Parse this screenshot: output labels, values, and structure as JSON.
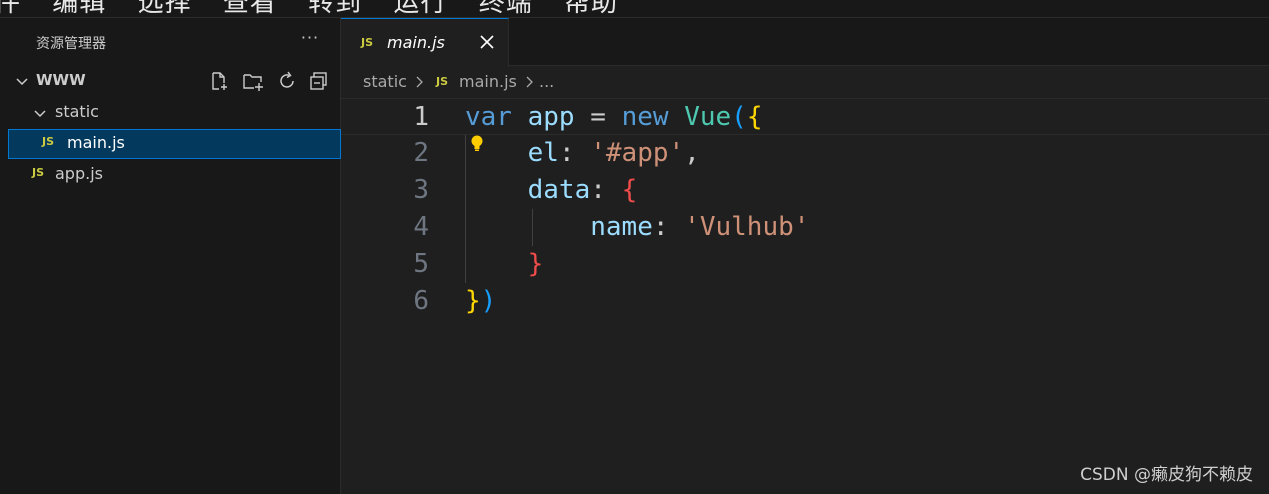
{
  "menubar": {
    "items": [
      "件",
      "编辑",
      "选择",
      "查看",
      "转到",
      "运行",
      "终端",
      "帮助"
    ]
  },
  "sidebar": {
    "title": "资源管理器",
    "more_label": "···",
    "root_folder": "WWW",
    "tree": [
      {
        "label": "static",
        "type": "folder",
        "expanded": true
      },
      {
        "label": "main.js",
        "type": "file",
        "lang_badge": "JS",
        "selected": true
      },
      {
        "label": "app.js",
        "type": "file",
        "lang_badge": "JS",
        "selected": false
      }
    ],
    "actions": [
      "new-file-icon",
      "new-folder-icon",
      "refresh-icon",
      "collapse-all-icon"
    ]
  },
  "editor": {
    "tab": {
      "label": "main.js",
      "badge": "JS"
    },
    "breadcrumb": {
      "folder": "static",
      "badge": "JS",
      "file": "main.js",
      "ellipsis": "..."
    },
    "lines": [
      {
        "num": "1",
        "tokens": [
          [
            "var",
            "kw"
          ],
          [
            " ",
            "p"
          ],
          [
            "app",
            "var"
          ],
          [
            " = ",
            "p"
          ],
          [
            "new",
            "kw"
          ],
          [
            " ",
            "p"
          ],
          [
            "Vue",
            "cls"
          ],
          [
            "(",
            "b2"
          ],
          [
            "{",
            "b1"
          ]
        ]
      },
      {
        "num": "2",
        "tokens": [
          [
            "    ",
            "p"
          ],
          [
            "el",
            "var"
          ],
          [
            ": ",
            "p"
          ],
          [
            "'#app'",
            "str"
          ],
          [
            ",",
            "p"
          ]
        ]
      },
      {
        "num": "3",
        "tokens": [
          [
            "    ",
            "p"
          ],
          [
            "data",
            "var"
          ],
          [
            ": ",
            "p"
          ],
          [
            "{",
            "b3"
          ]
        ]
      },
      {
        "num": "4",
        "tokens": [
          [
            "        ",
            "p"
          ],
          [
            "name",
            "var"
          ],
          [
            ": ",
            "p"
          ],
          [
            "'Vulhub'",
            "str"
          ]
        ]
      },
      {
        "num": "5",
        "tokens": [
          [
            "    ",
            "p"
          ],
          [
            "}",
            "b3"
          ]
        ]
      },
      {
        "num": "6",
        "tokens": [
          [
            "}",
            "b1"
          ],
          [
            ")",
            "b2"
          ]
        ]
      }
    ]
  },
  "colors": {
    "kw": "#569cd6",
    "var": "#9cdcfe",
    "cls": "#4ec9b0",
    "str": "#ce9178",
    "p": "#cccccc",
    "b1": "#ffd700",
    "b2": "#179fff",
    "b3": "#f14c4c",
    "accent": "#0078d4",
    "js_badge": "#cbcb41"
  },
  "watermark": "CSDN @癞皮狗不赖皮"
}
